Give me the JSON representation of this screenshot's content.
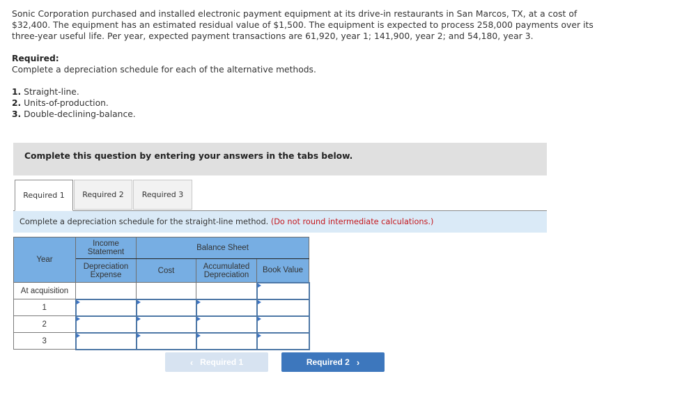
{
  "problem": {
    "paragraph": "Sonic Corporation purchased and installed electronic payment equipment at its drive-in restaurants in San Marcos, TX, at a cost of $32,400. The equipment has an estimated residual value of $1,500. The equipment is expected to process 258,000 payments over its three-year useful life. Per year, expected payment transactions are 61,920, year 1; 141,900, year 2; and 54,180, year 3.",
    "required_title": "Required:",
    "required_desc": "Complete a depreciation schedule for each of the alternative methods.",
    "items": [
      {
        "num": "1.",
        "text": "Straight-line."
      },
      {
        "num": "2.",
        "text": "Units-of-production."
      },
      {
        "num": "3.",
        "text": "Double-declining-balance."
      }
    ]
  },
  "banner": "Complete this question by entering your answers in the tabs below.",
  "tabs": [
    {
      "label": "Required 1",
      "active": true
    },
    {
      "label": "Required 2",
      "active": false
    },
    {
      "label": "Required 3",
      "active": false
    }
  ],
  "instruction": {
    "text": "Complete a depreciation schedule for the straight-line method.",
    "note": "(Do not round intermediate calculations.)"
  },
  "table": {
    "headers": {
      "year": "Year",
      "income_statement": "Income Statement",
      "balance_sheet": "Balance Sheet",
      "depreciation_expense": "Depreciation Expense",
      "cost": "Cost",
      "accumulated_depreciation": "Accumulated Depreciation",
      "book_value": "Book Value"
    },
    "rows": [
      {
        "year": "At acquisition",
        "depreciation_expense": null,
        "cost": null,
        "accumulated_depreciation": null,
        "book_value": ""
      },
      {
        "year": "1",
        "depreciation_expense": "",
        "cost": "",
        "accumulated_depreciation": "",
        "book_value": ""
      },
      {
        "year": "2",
        "depreciation_expense": "",
        "cost": "",
        "accumulated_depreciation": "",
        "book_value": ""
      },
      {
        "year": "3",
        "depreciation_expense": "",
        "cost": "",
        "accumulated_depreciation": "",
        "book_value": ""
      }
    ]
  },
  "nav": {
    "prev_label": "Required 1",
    "next_label": "Required 2",
    "prev_icon": "chevron-left-icon",
    "next_icon": "chevron-right-icon"
  },
  "colors": {
    "header_blue": "#77aee3",
    "instruction_bg": "#daeaf7",
    "note_red": "#c4161c",
    "next_button": "#3d77bd",
    "prev_button_disabled": "#d7e3f1",
    "banner_gray": "#e0e0e0"
  }
}
